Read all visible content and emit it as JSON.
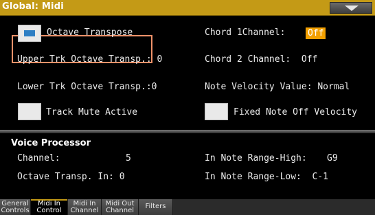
{
  "window": {
    "title": "Global: Midi",
    "menu_icon": "chevron-down-icon"
  },
  "controls": {
    "octave_transpose": {
      "label": "Octave Transpose",
      "checked": true
    },
    "upper_trk_octave_transp": "Upper Trk Octave Transp.: 0",
    "lower_trk_octave_transp": "Lower Trk Octave Transp.:0",
    "track_mute_active": {
      "label": "Track Mute Active",
      "checked": false
    },
    "chord1_channel": {
      "label": "Chord 1Channel:",
      "value": "Off"
    },
    "chord2_channel": "Chord 2 Channel:  Off",
    "note_velocity_value": "Note Velocity Value: Normal",
    "fixed_note_off_velocity": {
      "label": "Fixed Note Off Velocity",
      "checked": false
    }
  },
  "voice_processor": {
    "heading": "Voice Processor",
    "channel_label": "Channel:",
    "channel_value": "5",
    "octave_transp_in": "Octave Transp. In: 0",
    "note_range_high_label": "In Note Range-High:",
    "note_range_high_value": "G9",
    "note_range_low": "In Note Range-Low:  C-1"
  },
  "tabs": [
    {
      "line1": "General",
      "line2": "Controls",
      "active": false
    },
    {
      "line1": "Midi In",
      "line2": "Control",
      "active": true
    },
    {
      "line1": "Midi In",
      "line2": "Channel",
      "active": false
    },
    {
      "line1": "Midi Out",
      "line2": "Channel",
      "active": false
    },
    {
      "line1": "Filters",
      "line2": "",
      "active": false
    }
  ],
  "colors": {
    "title_bar": "#c49a16",
    "value_highlight": "#f2a000",
    "focus_outline": "#f0926a",
    "checkbox_mark": "#2e7fc4"
  }
}
